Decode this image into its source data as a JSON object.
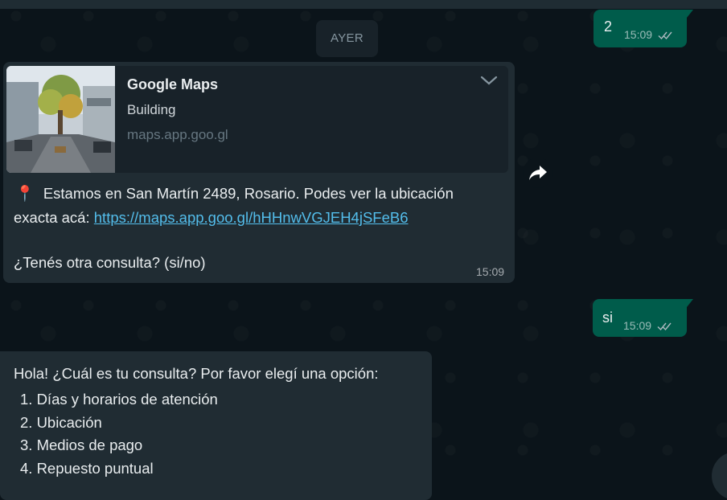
{
  "date_separator": "AYER",
  "messages": {
    "out_top": {
      "text": "2",
      "time": "15:09"
    },
    "in_location": {
      "preview": {
        "title": "Google Maps",
        "description": "Building",
        "domain": "maps.app.goo.gl",
        "thumbnail": "street-photo-icon"
      },
      "pin_icon": "📍",
      "line1": "Estamos en San Martín 2489, Rosario. Podes ver la ubicación",
      "line2_prefix": "exacta acá: ",
      "link": "https://maps.app.goo.gl/hHHnwVGJEH4jSFeB6",
      "question": "¿Tenés otra consulta? (si/no)",
      "time": "15:09"
    },
    "out_si": {
      "text": "si",
      "time": "15:09"
    },
    "in_menu": {
      "intro": "Hola! ¿Cuál es tu consulta? Por favor elegí una opción:",
      "options": [
        "1.  Días y horarios de atención",
        "2.  Ubicación",
        "3.  Medios de pago",
        "4.  Repuesto puntual"
      ]
    }
  },
  "icons": {
    "read_receipt": "double-check-icon",
    "forward": "forward-arrow-icon",
    "menu_toggle": "chevron-down-icon"
  },
  "colors": {
    "background": "#0b141a",
    "incoming_bubble": "#202c33",
    "outgoing_bubble": "#005c4b",
    "link": "#53bdeb",
    "preview_card": "#182229"
  }
}
